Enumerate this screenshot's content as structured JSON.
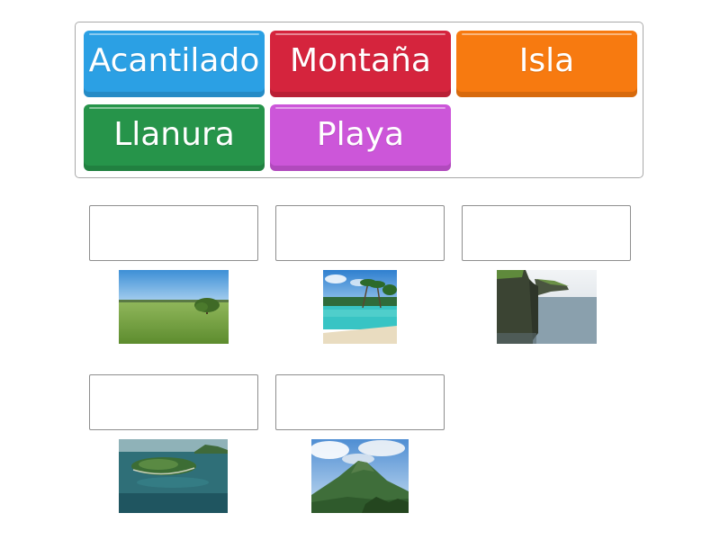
{
  "word_bank": {
    "tiles": [
      {
        "label": "Acantilado",
        "color": "#2ba0e4"
      },
      {
        "label": "Montaña",
        "color": "#d5243d"
      },
      {
        "label": "Isla",
        "color": "#f77a10"
      },
      {
        "label": "Llanura",
        "color": "#26944a"
      },
      {
        "label": "Playa",
        "color": "#cc56d9"
      }
    ]
  },
  "targets": [
    {
      "value": "",
      "image": "plain-field-with-tree"
    },
    {
      "value": "",
      "image": "tropical-beach-with-palms"
    },
    {
      "value": "",
      "image": "sea-cliffs"
    },
    {
      "value": "",
      "image": "island-in-sea"
    },
    {
      "value": "",
      "image": "green-mountain-peak"
    }
  ]
}
